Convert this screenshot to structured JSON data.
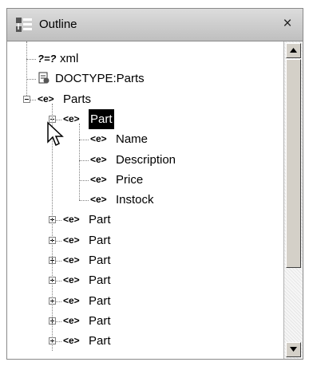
{
  "panel": {
    "title": "Outline",
    "close_glyph": "×",
    "title_icon": "outline-view-icon"
  },
  "tree": {
    "rows": [
      {
        "label": "xml",
        "icon": "?=?",
        "icon_name": "xml-declaration-icon",
        "depth": 0,
        "expander": "none"
      },
      {
        "label": "DOCTYPE:Parts",
        "icon": "doctype",
        "icon_name": "doctype-icon",
        "depth": 0,
        "expander": "none"
      },
      {
        "label": "Parts",
        "icon": "<e>",
        "icon_name": "element-icon",
        "depth": 0,
        "expander": "minus"
      },
      {
        "label": "Part",
        "icon": "<e>",
        "icon_name": "element-icon",
        "depth": 1,
        "expander": "minus",
        "selected": true
      },
      {
        "label": "Name",
        "icon": "<e>",
        "icon_name": "element-icon",
        "depth": 2,
        "expander": "none"
      },
      {
        "label": "Description",
        "icon": "<e>",
        "icon_name": "element-icon",
        "depth": 2,
        "expander": "none"
      },
      {
        "label": "Price",
        "icon": "<e>",
        "icon_name": "element-icon",
        "depth": 2,
        "expander": "none"
      },
      {
        "label": "Instock",
        "icon": "<e>",
        "icon_name": "element-icon",
        "depth": 2,
        "expander": "none"
      },
      {
        "label": "Part",
        "icon": "<e>",
        "icon_name": "element-icon",
        "depth": 1,
        "expander": "plus"
      },
      {
        "label": "Part",
        "icon": "<e>",
        "icon_name": "element-icon",
        "depth": 1,
        "expander": "plus"
      },
      {
        "label": "Part",
        "icon": "<e>",
        "icon_name": "element-icon",
        "depth": 1,
        "expander": "plus"
      },
      {
        "label": "Part",
        "icon": "<e>",
        "icon_name": "element-icon",
        "depth": 1,
        "expander": "plus"
      },
      {
        "label": "Part",
        "icon": "<e>",
        "icon_name": "element-icon",
        "depth": 1,
        "expander": "plus"
      },
      {
        "label": "Part",
        "icon": "<e>",
        "icon_name": "element-icon",
        "depth": 1,
        "expander": "plus"
      },
      {
        "label": "Part",
        "icon": "<e>",
        "icon_name": "element-icon",
        "depth": 1,
        "expander": "plus"
      }
    ]
  },
  "scrollbar": {
    "up_icon": "arrow-up-icon",
    "down_icon": "arrow-down-icon"
  },
  "colors": {
    "selection_bg": "#000000",
    "selection_fg": "#ffffff"
  }
}
